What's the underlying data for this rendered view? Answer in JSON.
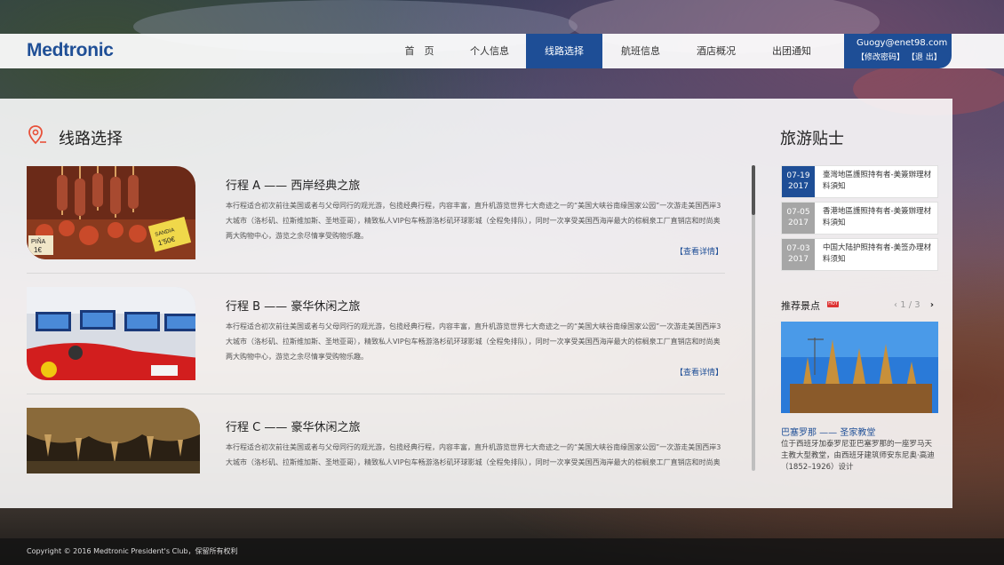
{
  "brand": {
    "logo": "Medtronic",
    "accent": "#1e4e96"
  },
  "nav": {
    "items": [
      {
        "label": "首　页"
      },
      {
        "label": "个人信息"
      },
      {
        "label": "线路选择",
        "active": true
      },
      {
        "label": "航班信息"
      },
      {
        "label": "酒店概况"
      },
      {
        "label": "出团通知"
      }
    ]
  },
  "user": {
    "email": "Guogy@enet98.com",
    "change_password": "【修改密码】",
    "logout": "【退  出】"
  },
  "routes": {
    "section_title": "线路选择",
    "items": [
      {
        "title": "行程 A —— 西岸经典之旅",
        "desc": "本行程适合初次前往美国或者与父母同行的观光游，包揽经典行程，内容丰富，直升机游览世界七大奇迹之一的“美国大峡谷南缘国家公园”一次游走美国西岸3大城市（洛杉矶、拉斯维加斯、圣地亚哥），精致私人VIP包车畅游洛杉矶环球影城（全程免排队），同时一次享受美国西海岸最大的棕榈泉工厂直销店和时尚奥两大购物中心，游览之余尽情享受购物乐趣。",
        "more": "【查看详情】",
        "image": "food-market-photo"
      },
      {
        "title": "行程 B —— 豪华休闲之旅",
        "desc": "本行程适合初次前往美国或者与父母同行的观光游，包揽经典行程，内容丰富，直升机游览世界七大奇迹之一的“美国大峡谷南缘国家公园”一次游走美国西岸3大城市（洛杉矶、拉斯维加斯、圣地亚哥），精致私人VIP包车畅游洛杉矶环球影城（全程免排队），同时一次享受美国西海岸最大的棕榈泉工厂直销店和时尚奥两大购物中心，游览之余尽情享受购物乐趣。",
        "more": "【查看详情】",
        "image": "racing-simulator-photo"
      },
      {
        "title": "行程 C —— 豪华休闲之旅",
        "desc": "本行程适合初次前往美国或者与父母同行的观光游，包揽经典行程，内容丰富，直升机游览世界七大奇迹之一的“美国大峡谷南缘国家公园”一次游走美国西岸3大城市（洛杉矶、拉斯维加斯、圣地亚哥），精致私人VIP包车畅游洛杉矶环球影城（全程免排队），同时一次享受美国西海岸最大的棕榈泉工厂直销店和时尚奥两大购物中心，游览之余尽情享受购物乐趣。",
        "more": "【查看详情】",
        "image": "cave-photo"
      }
    ],
    "scroll_progress": 0.0
  },
  "tips": {
    "title": "旅游贴士",
    "items": [
      {
        "day": "07-19",
        "year": "2017",
        "text": "臺灣地區護照持有者-美簽辦理材料須知",
        "active": true
      },
      {
        "day": "07-05",
        "year": "2017",
        "text": "香港地區護照持有者-美簽辦理材料須知",
        "active": false
      },
      {
        "day": "07-03",
        "year": "2017",
        "text": "中国大陆护照持有者-美签办理材料须知",
        "active": false
      }
    ]
  },
  "recommend": {
    "title": "推荐景点",
    "badge": "HOT",
    "page_current": "1",
    "page_total": "3",
    "page_sep": " / ",
    "prev": "‹",
    "next": "›",
    "name": "巴塞罗那 —— 圣家教堂",
    "desc": "位于西班牙加泰罗尼亚巴塞罗那的一座罗马天主教大型教堂，由西班牙建筑师安东尼奥·高迪（1852–1926）设计",
    "image": "sagrada-familia-photo"
  },
  "footer": {
    "copyright": "Copyright © 2016 Medtronic President's Club，保留所有权利"
  }
}
